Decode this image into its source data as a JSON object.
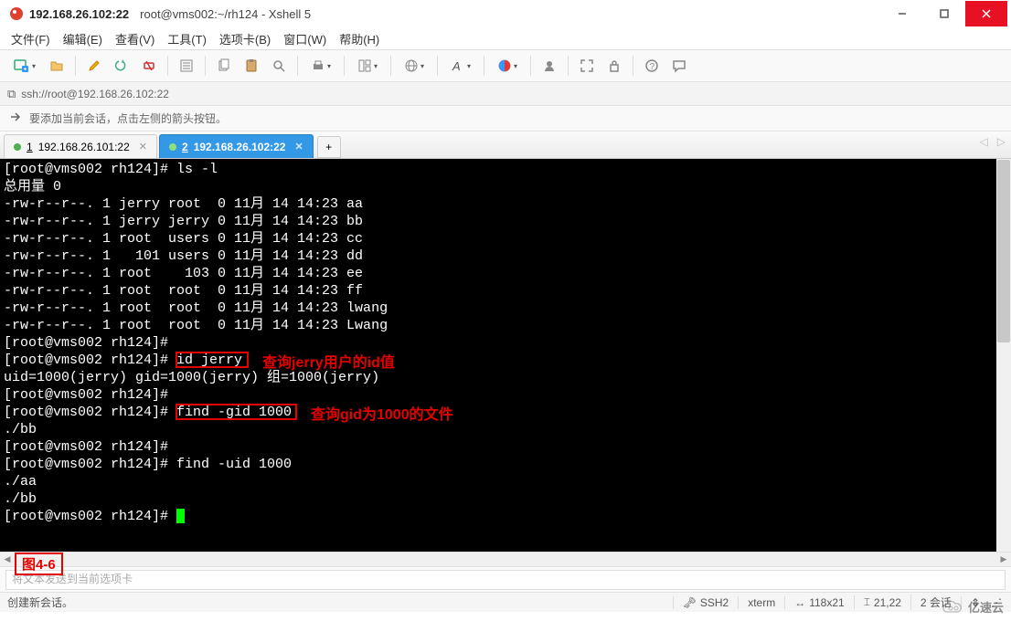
{
  "window": {
    "title": "192.168.26.102:22",
    "subtitle": "root@vms002:~/rh124 - Xshell 5"
  },
  "menu": [
    "文件(F)",
    "编辑(E)",
    "查看(V)",
    "工具(T)",
    "选项卡(B)",
    "窗口(W)",
    "帮助(H)"
  ],
  "address": "ssh://root@192.168.26.102:22",
  "hint": "要添加当前会话，点击左侧的箭头按钮。",
  "tabs": [
    {
      "num": "1",
      "label": "192.168.26.101:22",
      "active": false
    },
    {
      "num": "2",
      "label": "192.168.26.102:22",
      "active": true
    }
  ],
  "terminal": {
    "lines": [
      "[root@vms002 rh124]# ls -l",
      "总用量 0",
      "-rw-r--r--. 1 jerry root  0 11月 14 14:23 aa",
      "-rw-r--r--. 1 jerry jerry 0 11月 14 14:23 bb",
      "-rw-r--r--. 1 root  users 0 11月 14 14:23 cc",
      "-rw-r--r--. 1   101 users 0 11月 14 14:23 dd",
      "-rw-r--r--. 1 root    103 0 11月 14 14:23 ee",
      "-rw-r--r--. 1 root  root  0 11月 14 14:23 ff",
      "-rw-r--r--. 1 root  root  0 11月 14 14:23 lwang",
      "-rw-r--r--. 1 root  root  0 11月 14 14:23 Lwang",
      "[root@vms002 rh124]#",
      "[root@vms002 rh124]# id jerry",
      "uid=1000(jerry) gid=1000(jerry) 组=1000(jerry)",
      "[root@vms002 rh124]#",
      "[root@vms002 rh124]# find -gid 1000",
      "./bb",
      "[root@vms002 rh124]#",
      "[root@vms002 rh124]# find -uid 1000",
      "./aa",
      "./bb",
      "[root@vms002 rh124]# "
    ]
  },
  "annotations": {
    "box1_cmd": "id jerry",
    "label1": "查询jerry用户的id值",
    "box2_cmd": "find -gid 1000",
    "label2": "查询gid为1000的文件",
    "figure": "图4-6"
  },
  "input_placeholder": "将文本发送到当前选项卡",
  "status": {
    "left": "创建新会话。",
    "ssh": "SSH2",
    "term": "xterm",
    "size": "118x21",
    "pos": "21,22",
    "sessions": "2 会话"
  },
  "watermark": "亿速云"
}
